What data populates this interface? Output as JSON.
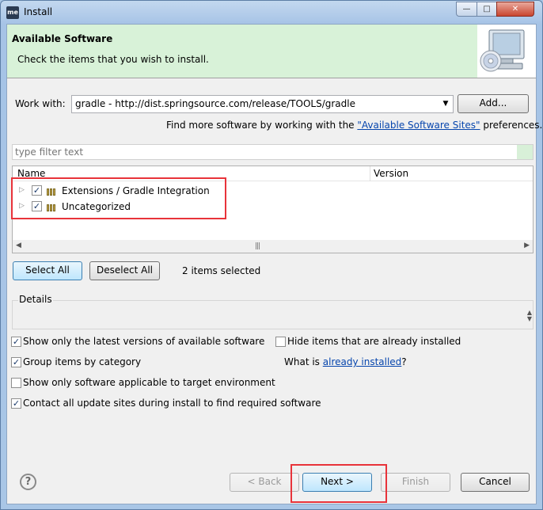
{
  "window": {
    "title": "Install",
    "app_icon_text": "me"
  },
  "header": {
    "title": "Available Software",
    "description": "Check the items that you wish to install."
  },
  "work_with": {
    "label": "Work with:",
    "value": "gradle - http://dist.springsource.com/release/TOOLS/gradle",
    "add_label": "Add..."
  },
  "sites_line": {
    "prefix": "Find more software by working with the ",
    "link": "\"Available Software Sites\"",
    "suffix": " preferences."
  },
  "filter": {
    "placeholder": "type filter text"
  },
  "tree": {
    "columns": [
      "Name",
      "Version"
    ],
    "items": [
      {
        "label": "Extensions / Gradle Integration",
        "checked": true
      },
      {
        "label": "Uncategorized",
        "checked": true
      }
    ]
  },
  "selection": {
    "select_all": "Select All",
    "deselect_all": "Deselect All",
    "status": "2 items selected"
  },
  "details": {
    "label": "Details"
  },
  "options": {
    "latest_versions": "Show only the latest versions of available software",
    "hide_installed": "Hide items that are already installed",
    "group_by_category": "Group items by category",
    "what_is_prefix": "What is ",
    "already_installed_link": "already installed",
    "what_is_suffix": "?",
    "target_env": "Show only software applicable to target environment",
    "contact_sites": "Contact all update sites during install to find required software"
  },
  "footer": {
    "back": "< Back",
    "next": "Next >",
    "finish": "Finish",
    "cancel": "Cancel"
  },
  "colors": {
    "highlight": "#e8333a",
    "header_green": "#d8f2d8",
    "link": "#0645ad"
  }
}
